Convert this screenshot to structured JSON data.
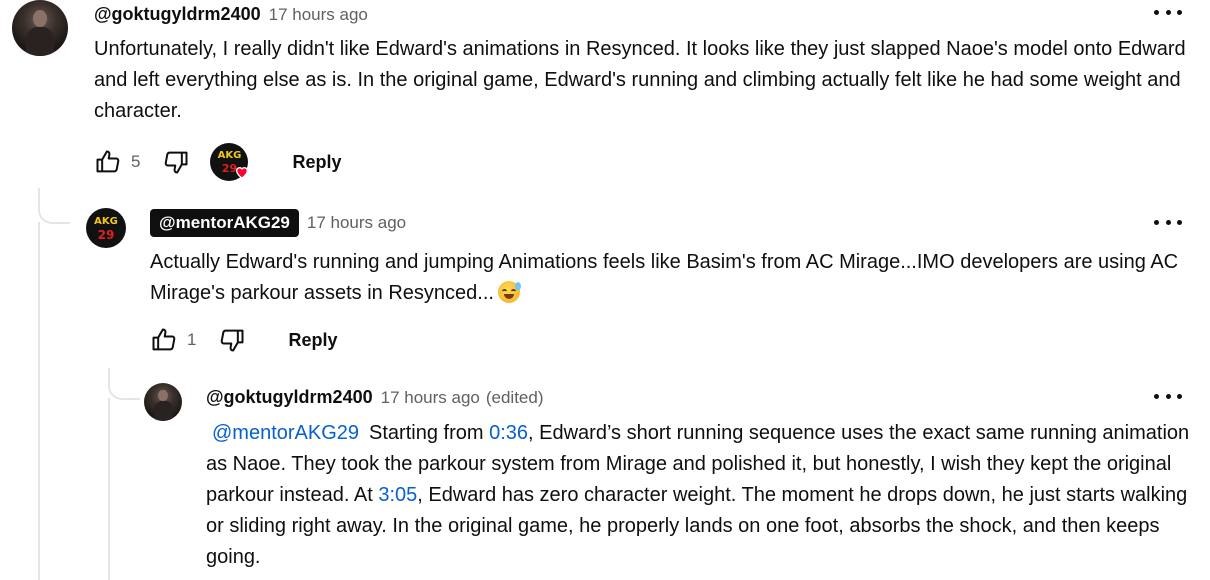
{
  "comments": [
    {
      "username": "@goktugyldrm2400",
      "time": "17 hours ago",
      "text": "Unfortunately, I really didn't like Edward's animations in Resynced. It looks like they just slapped Naoe's model onto Edward and left everything else as is. In the original game, Edward's running and climbing actually felt like he had some weight and character.",
      "likes": "5",
      "reply_label": "Reply",
      "creator_heart_avatar_text_top": "AKG",
      "creator_heart_avatar_text_bottom": "29",
      "more_icon": "more-vert-icon"
    },
    {
      "username": "@mentorAKG29",
      "time": "17 hours ago",
      "avatar_text_top": "AKG",
      "avatar_text_bottom": "29",
      "text": "Actually Edward's running and jumping Animations feels like Basim's from AC Mirage...IMO developers are using AC Mirage's parkour assets in Resynced...",
      "emoji": "grinning-face-with-sweat",
      "likes": "1",
      "reply_label": "Reply"
    },
    {
      "username": "@goktugyldrm2400",
      "time": "17 hours ago",
      "edited": "(edited)",
      "mention": "@mentorAKG29",
      "text_1": "Starting from ",
      "timestamp_1": "0:36",
      "text_2": ", Edward’s short running sequence uses the exact same running animation as Naoe. They took the parkour system from Mirage and polished it, but honestly, I wish they kept the original parkour instead. At ",
      "timestamp_2": "3:05",
      "text_3": ", Edward has zero character weight. The moment he drops down, he just starts walking or sliding right away. In the original game, he properly lands on one foot, absorbs the shock, and then keeps going."
    }
  ],
  "colors": {
    "link": "#065fd4",
    "meta": "#606060",
    "heart": "#ff0033",
    "akg_yellow": "#f2c81a",
    "akg_red": "#e02020"
  }
}
